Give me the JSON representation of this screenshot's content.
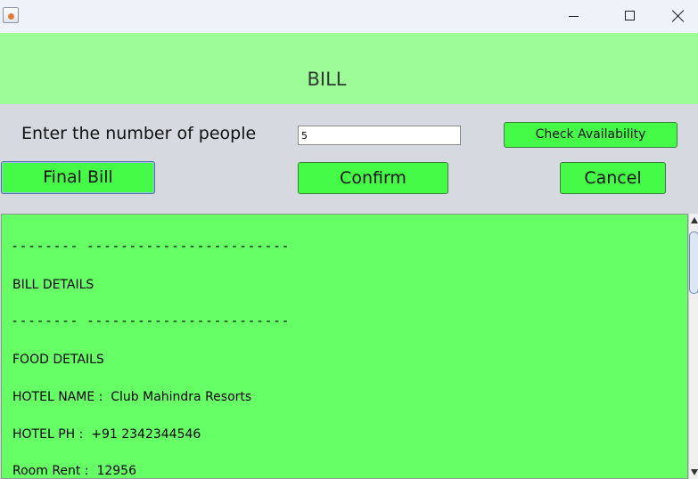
{
  "window": {
    "icon": "java-cup-icon"
  },
  "header": {
    "title": "BILL",
    "bg_color": "#9dfc98"
  },
  "form": {
    "people_label": "Enter the number of people",
    "people_value": "5",
    "check_label": "Check Availability"
  },
  "actions": {
    "final_bill_label": "Final Bill",
    "confirm_label": "Confirm",
    "cancel_label": "Cancel",
    "button_color": "#46fb48"
  },
  "bill": {
    "bg_color": "#66ff66",
    "lines": [
      "- - - - - - - -   - - - - - - - - - - - - - - - - - - - - - - - -",
      "BILL DETAILS",
      "- - - - - - - -   - - - - - - - - - - - - - - - - - - - - - - - -",
      "FOOD DETAILS",
      "HOTEL NAME :  Club Mahindra Resorts",
      "HOTEL PH :  +91 2342344546",
      "Room Rent :  12956"
    ]
  }
}
